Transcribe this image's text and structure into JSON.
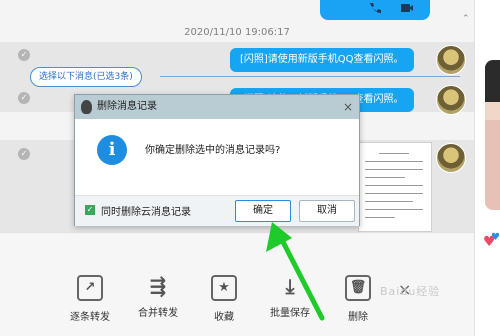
{
  "chat": {
    "timestamp": "2020/11/10 19:06:17",
    "flash_message_1": "[闪照]请使用新版手机QQ查看闪照。",
    "flash_message_2": "[闪照]请使用新版手机QQ查看闪照。",
    "select_pill": "选择以下消息(已选3条)"
  },
  "dialog": {
    "title": "删除消息记录",
    "close": "×",
    "message": "你确定删除选中的消息记录吗?",
    "info_glyph": "i",
    "checkbox_label": "同时删除云消息记录",
    "checkbox_checked": true,
    "ok_label": "确定",
    "cancel_label": "取消"
  },
  "toolbar": {
    "items": [
      {
        "label": "逐条转发",
        "icon": "forward-icon"
      },
      {
        "label": "合并转发",
        "icon": "merge-forward-icon"
      },
      {
        "label": "收藏",
        "icon": "bookmark-icon"
      },
      {
        "label": "批量保存",
        "icon": "download-icon"
      },
      {
        "label": "删除",
        "icon": "trash-icon"
      }
    ],
    "close": "×"
  },
  "watermark": "Baidu经验",
  "colors": {
    "accent": "#16a5f3",
    "dialog_title_bg": "#b9cbd3",
    "arrow": "#1ecb2a",
    "check_green": "#3aa65a"
  }
}
